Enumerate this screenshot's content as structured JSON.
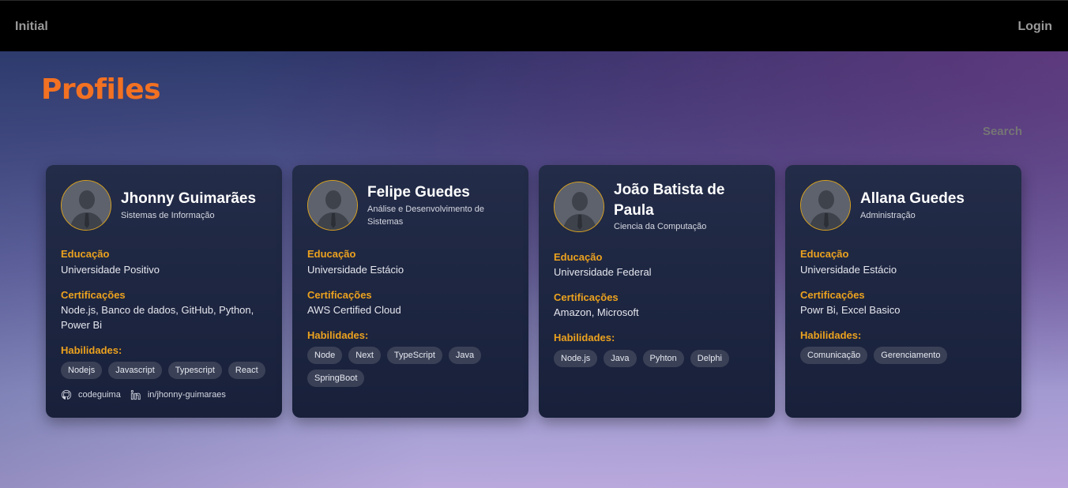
{
  "nav": {
    "initial": "Initial",
    "login": "Login"
  },
  "page": {
    "title": "Profiles"
  },
  "search": {
    "placeholder": "Search"
  },
  "labels": {
    "education": "Educação",
    "certifications": "Certificações",
    "skills": "Habilidades:"
  },
  "colors": {
    "accent": "#f27122",
    "label": "#eca21e",
    "card": "#1e2640",
    "chip": "#3a4157"
  },
  "profiles": [
    {
      "name": "Jhonny Guimarães",
      "course": "Sistemas de Informação",
      "education": "Universidade Positivo",
      "certifications": "Node.js, Banco de dados, GitHub, Python, Power Bi",
      "skills": [
        "Nodejs",
        "Javascript",
        "Typescript",
        "React"
      ],
      "github": "codeguima",
      "linkedin": "in/jhonny-guimaraes"
    },
    {
      "name": "Felipe Guedes",
      "course": "Análise e Desenvolvimento de Sistemas",
      "education": "Universidade Estácio",
      "certifications": "AWS Certified Cloud",
      "skills": [
        "Node",
        "Next",
        "TypeScript",
        "Java",
        "SpringBoot"
      ]
    },
    {
      "name": "João Batista de Paula",
      "course": "Ciencia da Computação",
      "education": "Universidade Federal",
      "certifications": "Amazon, Microsoft",
      "skills": [
        "Node.js",
        "Java",
        "Pyhton",
        "Delphi"
      ]
    },
    {
      "name": "Allana Guedes",
      "course": "Administração",
      "education": "Universidade Estácio",
      "certifications": "Powr Bi, Excel Basico",
      "skills": [
        "Comunicação",
        "Gerenciamento"
      ]
    }
  ]
}
